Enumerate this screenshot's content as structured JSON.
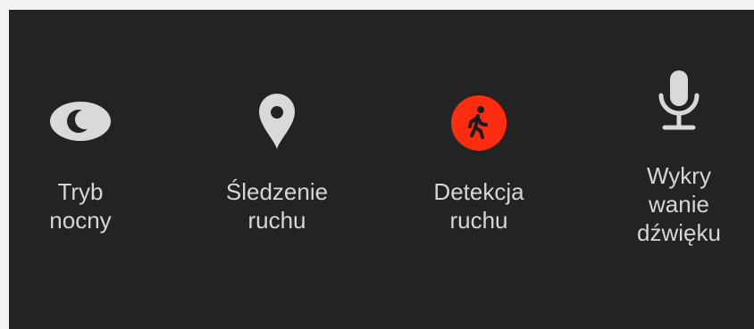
{
  "features": [
    {
      "icon": "moon-icon",
      "label_lines": [
        "Tryb",
        "nocny"
      ],
      "active": false
    },
    {
      "icon": "location-pin-icon",
      "label_lines": [
        "Śledzenie",
        "ruchu"
      ],
      "active": false
    },
    {
      "icon": "walking-person-icon",
      "label_lines": [
        "Detekcja",
        "ruchu"
      ],
      "active": true
    },
    {
      "icon": "microphone-icon",
      "label_lines": [
        "Wykry",
        "wanie",
        "dźwięku"
      ],
      "active": false
    }
  ],
  "colors": {
    "background": "#232323",
    "icon_inactive": "#d9d9d9",
    "icon_active": "#ff2d0f",
    "label": "#d6d6d6"
  }
}
